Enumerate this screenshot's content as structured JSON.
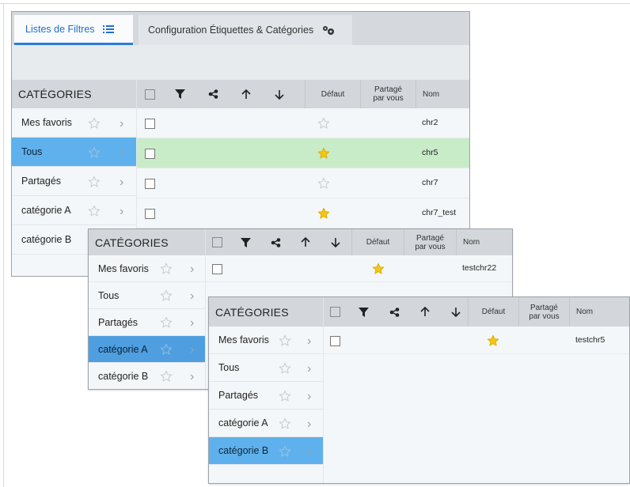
{
  "tabs": [
    {
      "label": "Listes de Filtres",
      "icon": "list-icon",
      "active": true
    },
    {
      "label": "Configuration Étiquettes & Catégories",
      "icon": "gears-icon",
      "active": false
    }
  ],
  "categories_header": "CATÉGORIES",
  "columns": {
    "default": "Défaut",
    "shared_line1": "Partagé",
    "shared_line2": "par vous",
    "name": "Nom"
  },
  "toolbar_icons": [
    "checkbox-all",
    "filter-icon",
    "share-icon",
    "arrow-up-icon",
    "arrow-down-icon"
  ],
  "panels": [
    {
      "categories": [
        {
          "label": "Mes favoris",
          "selected": false
        },
        {
          "label": "Tous",
          "selected": true
        },
        {
          "label": "Partagés",
          "selected": false
        },
        {
          "label": "catégorie A",
          "selected": false
        },
        {
          "label": "catégorie B",
          "selected": false
        }
      ],
      "rows": [
        {
          "name": "chr2",
          "default": false
        },
        {
          "name": "chr5",
          "default": true,
          "highlight": true
        },
        {
          "name": "chr7",
          "default": false
        },
        {
          "name": "chr7_test",
          "default": true
        }
      ]
    },
    {
      "categories": [
        {
          "label": "Mes favoris",
          "selected": false
        },
        {
          "label": "Tous",
          "selected": false
        },
        {
          "label": "Partagés",
          "selected": false
        },
        {
          "label": "catégorie A",
          "selected": true
        },
        {
          "label": "catégorie B",
          "selected": false
        }
      ],
      "rows": [
        {
          "name": "testchr22",
          "default": true
        }
      ]
    },
    {
      "categories": [
        {
          "label": "Mes favoris",
          "selected": false
        },
        {
          "label": "Tous",
          "selected": false
        },
        {
          "label": "Partagés",
          "selected": false
        },
        {
          "label": "catégorie A",
          "selected": false
        },
        {
          "label": "catégorie B",
          "selected": true
        }
      ],
      "rows": [
        {
          "name": "testchr5",
          "default": true
        }
      ]
    }
  ],
  "colors": {
    "accent": "#2b7be0",
    "selected_category": "#5eb1ec",
    "highlight_row": "#c8ecc8",
    "star_filled": "#f5c518",
    "star_empty": "#c9ced3"
  }
}
